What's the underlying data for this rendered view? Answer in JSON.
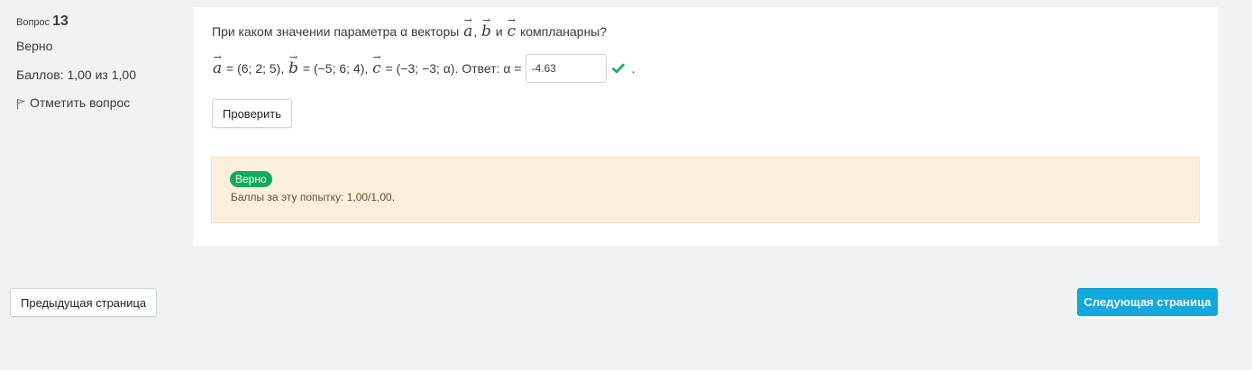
{
  "info": {
    "question_label": "Вопрос",
    "question_number": "13",
    "state": "Верно",
    "grade": "Баллов: 1,00 из 1,00",
    "flag_label": "Отметить вопрос"
  },
  "question": {
    "prompt_start": "При каком значении параметра α векторы",
    "comma": ",",
    "and": "и",
    "prompt_end": "компланарны?",
    "vec_a": "a",
    "vec_b": "b",
    "vec_c": "c",
    "arrow": "→",
    "a_coords": "= (6; 2; 5),",
    "b_coords": "= (−5; 6; 4),",
    "c_coords": "= (−3; −3; α). Ответ: α =",
    "answer_value": "-4.63",
    "period": ".",
    "check_button": "Проверить"
  },
  "feedback": {
    "badge": "Верно",
    "mark": "Баллы за эту попытку: 1,00/1,00."
  },
  "nav": {
    "prev": "Предыдущая страница",
    "next": "Следующая страница"
  },
  "colors": {
    "badge_green": "#10ac56",
    "feedback_bg": "#fcefdc",
    "next_blue": "#0fa9e0"
  }
}
